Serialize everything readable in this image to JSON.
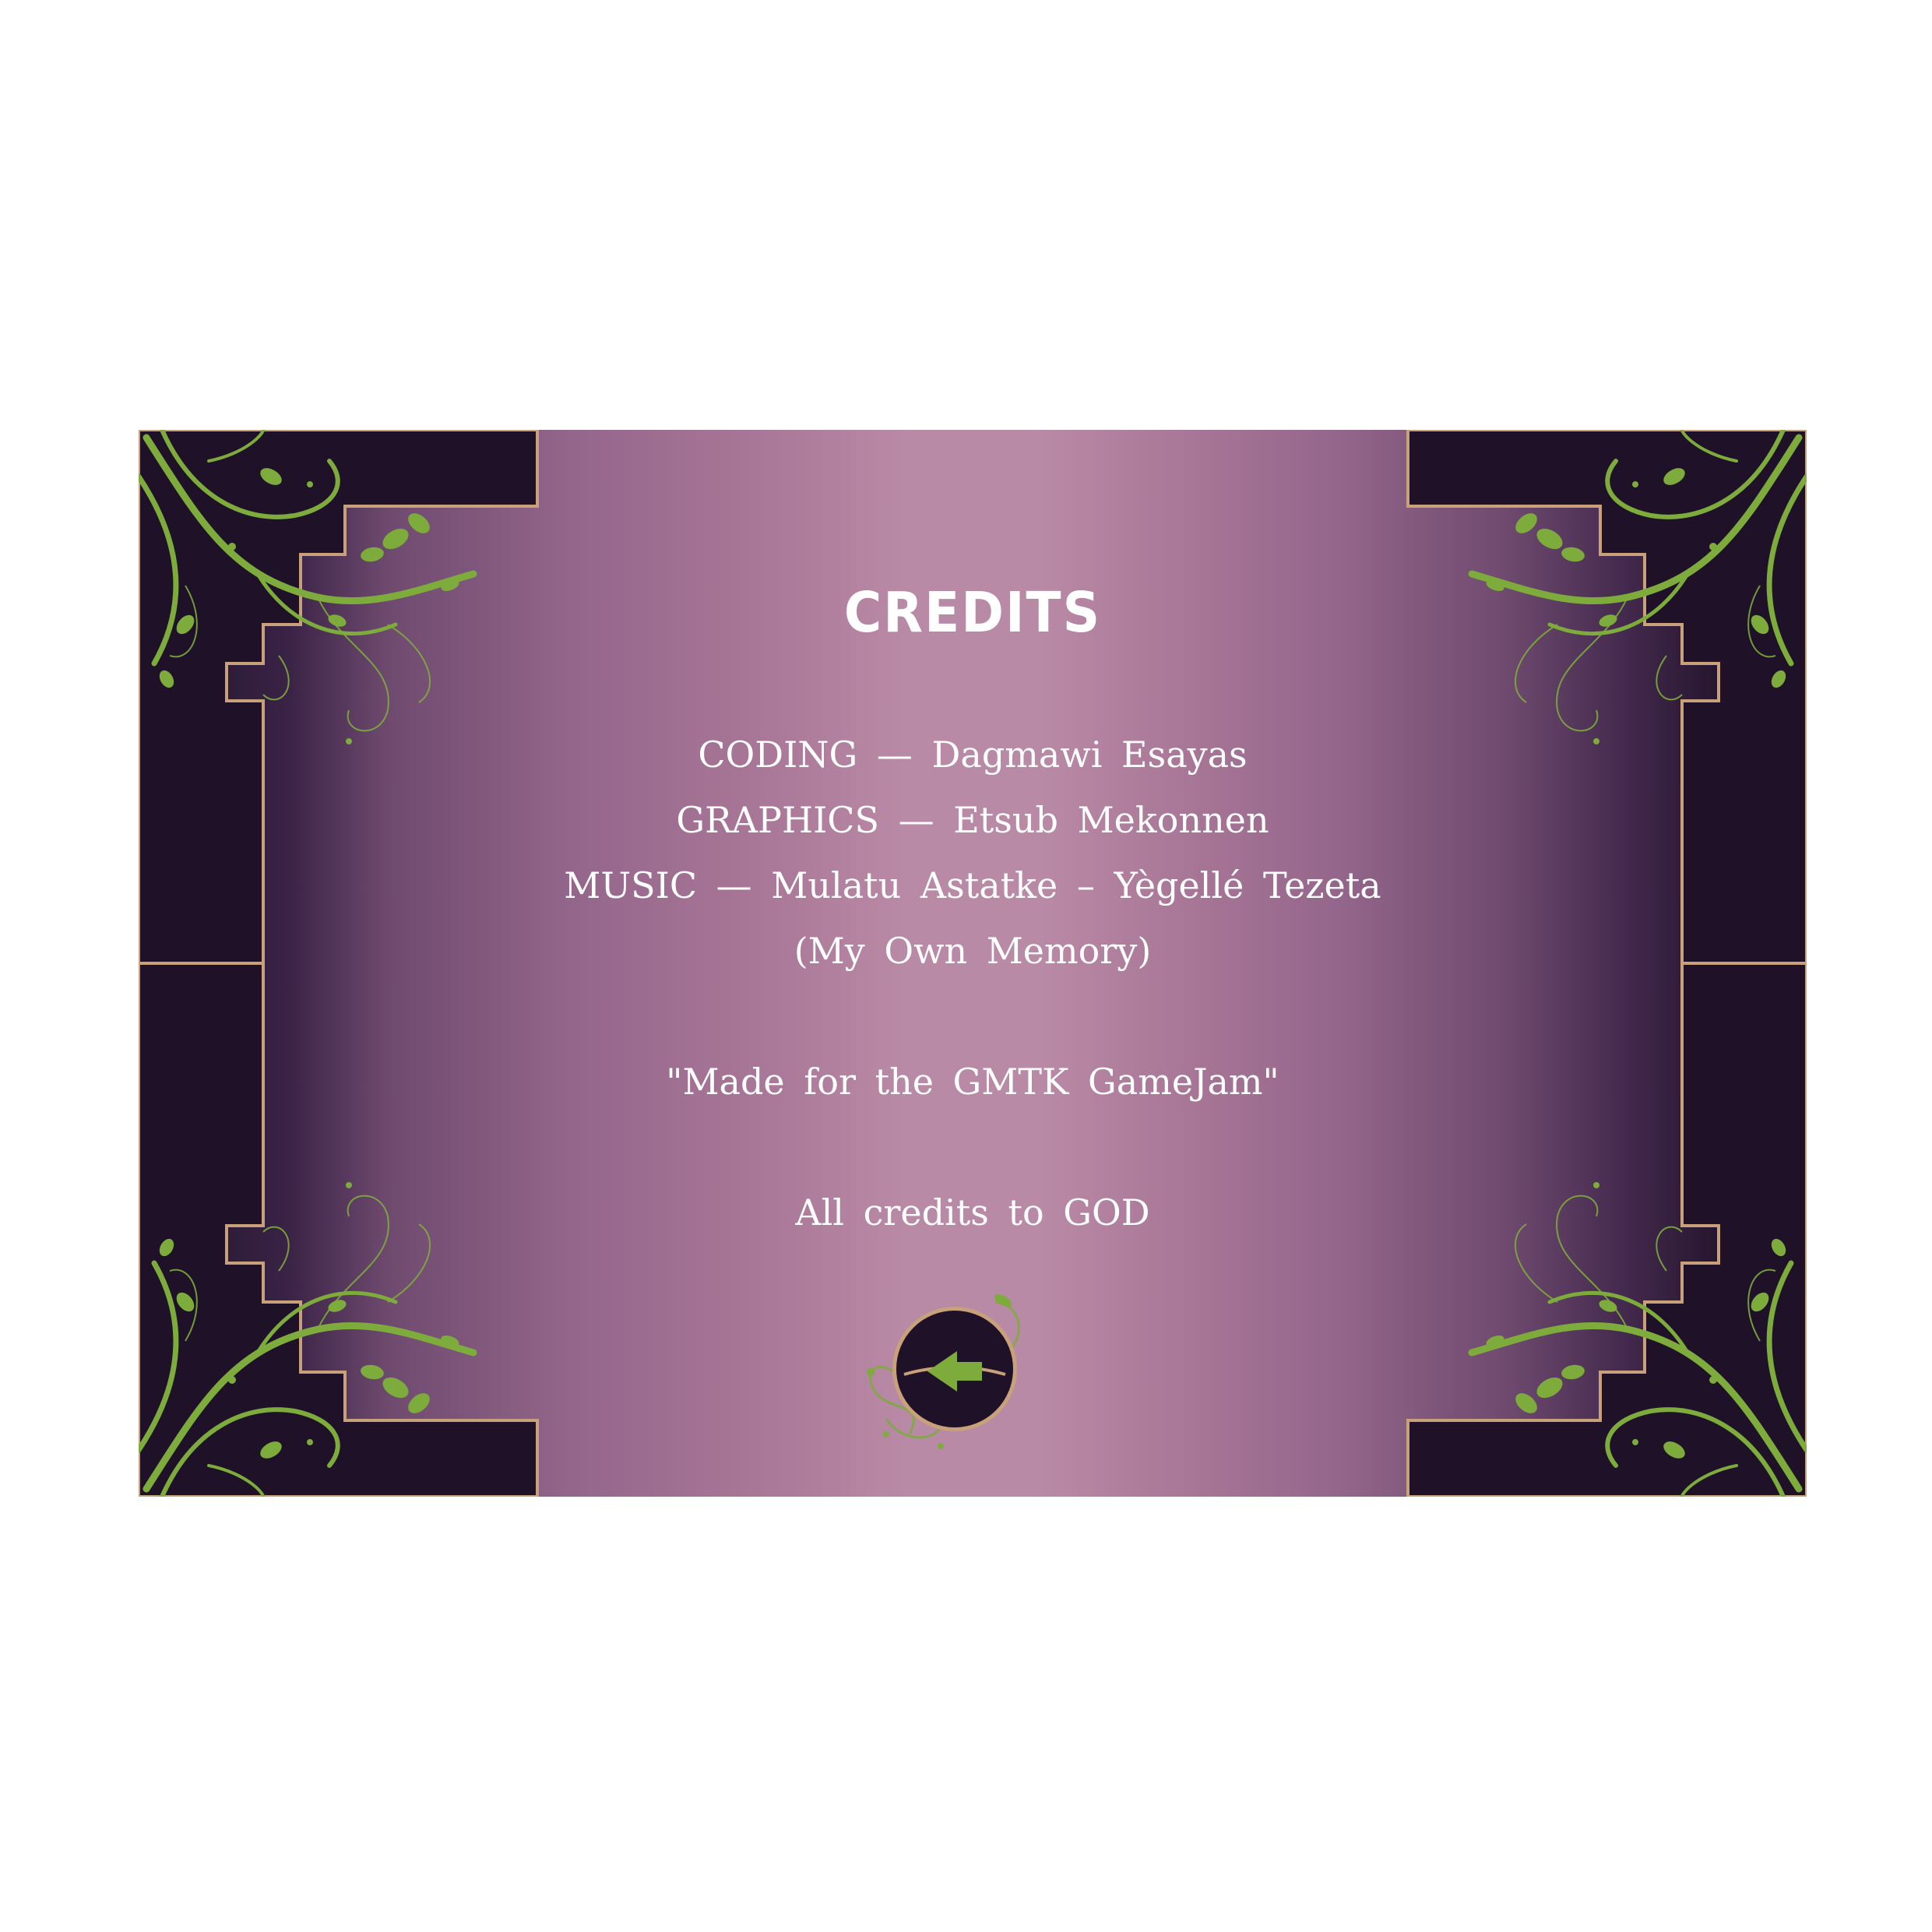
{
  "screen": {
    "title": "CREDITS",
    "credits": [
      "CODING — Dagmawi Esayas",
      "GRAPHICS — Etsub Mekonnen",
      "MUSIC — Mulatu Astatke – Yègellé Tezeta",
      "(My Own Memory)"
    ],
    "tagline": "\"Made for the GMTK GameJam\"",
    "dedication": "All credits to GOD",
    "back_icon": "back-arrow-icon"
  },
  "colors": {
    "frame_dark": "#1e1128",
    "frame_border": "#c8a07a",
    "vine_green": "#7dab3c",
    "panel_center": "#b98aa6",
    "text": "#ffffff"
  }
}
